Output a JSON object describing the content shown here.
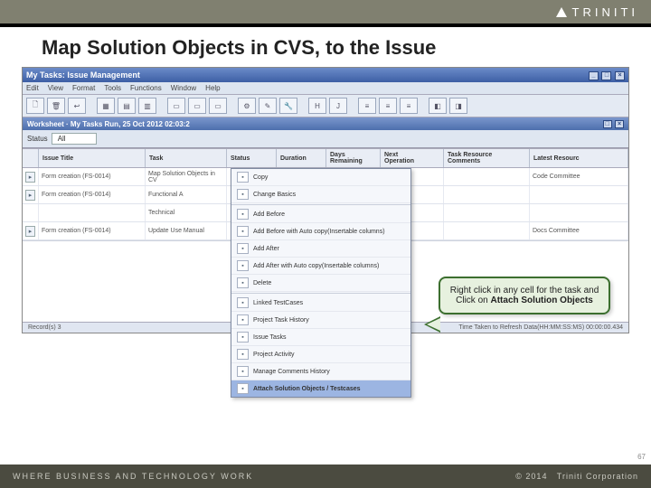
{
  "brand": {
    "name": "TRINITI",
    "footer_text": "WHERE BUSINESS AND TECHNOLOGY WORK",
    "year": "2014",
    "corp": "Triniti Corporation"
  },
  "slide": {
    "title": "Map Solution Objects in CVS, to the Issue",
    "page_number": "67"
  },
  "window": {
    "title": "My Tasks: Issue Management",
    "menus": [
      "Edit",
      "View",
      "Format",
      "Tools",
      "Functions",
      "Window",
      "Help"
    ],
    "worksheet_title": "Worksheet · My Tasks Run, 25 Oct 2012 02:03:2",
    "status_label": "Status",
    "status_value": "All",
    "columns": {
      "issue": "Issue Title",
      "task": "Task",
      "status": "Status",
      "duration": "Duration",
      "days": "Days\nRemaining",
      "next": "Next\nOperation",
      "resource": "Task Resource\nComments",
      "latest": "Latest Resourc"
    },
    "rows": [
      {
        "issue": "Form creation (FS-0014)",
        "task": "Map Solution Objects in CV",
        "latest": "Code Committee"
      },
      {
        "issue": "Form creation (FS-0014)",
        "task": "Functional A",
        "latest": ""
      },
      {
        "issue": "",
        "task": "Technical",
        "latest": ""
      },
      {
        "issue": "Form creation (FS-0014)",
        "task": "Update Use Manual",
        "latest": "Docs Committee"
      }
    ],
    "context_menu": [
      {
        "label": "Copy",
        "icon": "copy-icon"
      },
      {
        "label": "Change Basics",
        "icon": "edit-icon"
      },
      {
        "sep": true
      },
      {
        "label": "Add Before",
        "icon": "row-add-icon"
      },
      {
        "label": "Add Before with Auto copy(Insertable columns)",
        "icon": "row-add-icon"
      },
      {
        "label": "Add After",
        "icon": "row-add-icon"
      },
      {
        "label": "Add After with Auto copy(Insertable columns)",
        "icon": "row-add-icon"
      },
      {
        "label": "Delete",
        "icon": "delete-icon"
      },
      {
        "sep": true
      },
      {
        "label": "Linked TestCases",
        "icon": "link-icon"
      },
      {
        "label": "Project Task History",
        "icon": "history-icon"
      },
      {
        "label": "Issue Tasks",
        "icon": "task-icon"
      },
      {
        "label": "Project Activity",
        "icon": "activity-icon"
      },
      {
        "label": "Manage Comments History",
        "icon": "comment-icon"
      },
      {
        "label": "Attach Solution Objects / Testcases",
        "icon": "attach-icon",
        "selected": true,
        "bold": true
      }
    ],
    "statusbar_left": "Record(s) 3",
    "statusbar_right": "Time Taken to Refresh Data(HH:MM:SS:MS) 00:00:00.434"
  },
  "callout": {
    "text_before": "Right click in any cell for the task and Click on ",
    "bold": "Attach Solution Objects"
  }
}
